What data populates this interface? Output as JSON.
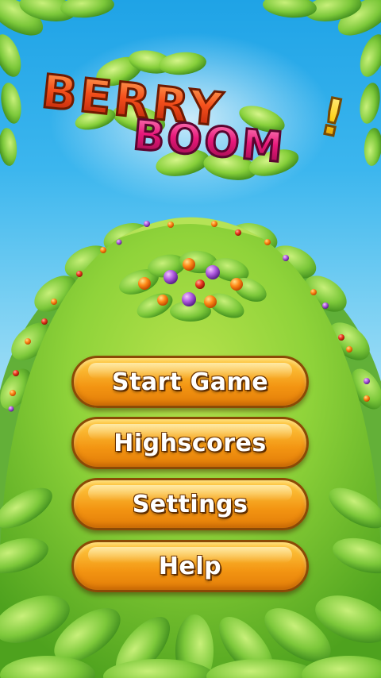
{
  "game": {
    "title_line1": "BERRY",
    "title_line2": "BOOM",
    "title_exclaim": "!"
  },
  "menu": {
    "start_label": "Start Game",
    "highscores_label": "Highscores",
    "settings_label": "Settings",
    "help_label": "Help"
  },
  "colors": {
    "sky": "#3cb6ee",
    "hill": "#8fd33a",
    "button": "#f9a61f",
    "title_red": "#e8401a",
    "title_pink": "#e0186e",
    "title_yellow": "#ffd21a"
  }
}
